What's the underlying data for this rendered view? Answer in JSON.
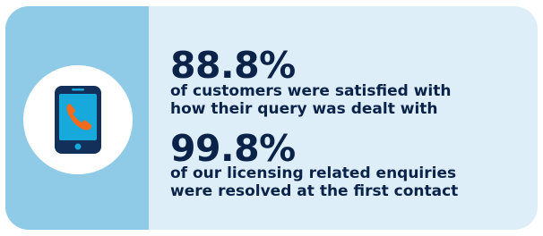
{
  "stats": [
    {
      "value": "88.8%",
      "line1": "of customers were satisfied with",
      "line2": "how their query was dealt with"
    },
    {
      "value": "99.8%",
      "line1": "of our licensing related enquiries",
      "line2": "were resolved at the first contact"
    }
  ],
  "icon": "mobile-phone-call-icon",
  "colors": {
    "card_background": "#ddeef9",
    "left_panel": "#8fcbe6",
    "text": "#0b2348",
    "phone_body": "#12305a",
    "phone_screen": "#17a8dc",
    "handset": "#f26a1b"
  }
}
